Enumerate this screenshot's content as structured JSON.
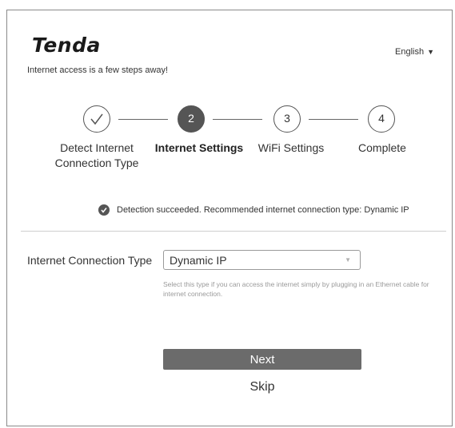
{
  "brand": {
    "logo": "Tenda",
    "tagline": "Internet access is a few steps away!"
  },
  "language": {
    "label": "English",
    "caret_icon": "triangle-down"
  },
  "steps": [
    {
      "marker": "",
      "label": "Detect Internet Connection Type",
      "state": "done"
    },
    {
      "marker": "2",
      "label": "Internet Settings",
      "state": "active"
    },
    {
      "marker": "3",
      "label": "WiFi Settings",
      "state": "pending"
    },
    {
      "marker": "4",
      "label": "Complete",
      "state": "pending"
    }
  ],
  "detection": {
    "message": "Detection succeeded. Recommended internet connection type: Dynamic IP",
    "icon": "check-circle"
  },
  "connection": {
    "label": "Internet Connection Type",
    "selected": "Dynamic IP",
    "hint": "Select this type if you can access the internet simply by plugging in an Ethernet cable for internet connection."
  },
  "actions": {
    "next_label": "Next",
    "skip_label": "Skip"
  },
  "colors": {
    "active_step": "#555555",
    "button": "#6b6b6b",
    "text": "#333333",
    "hint": "#9a9a9a"
  }
}
